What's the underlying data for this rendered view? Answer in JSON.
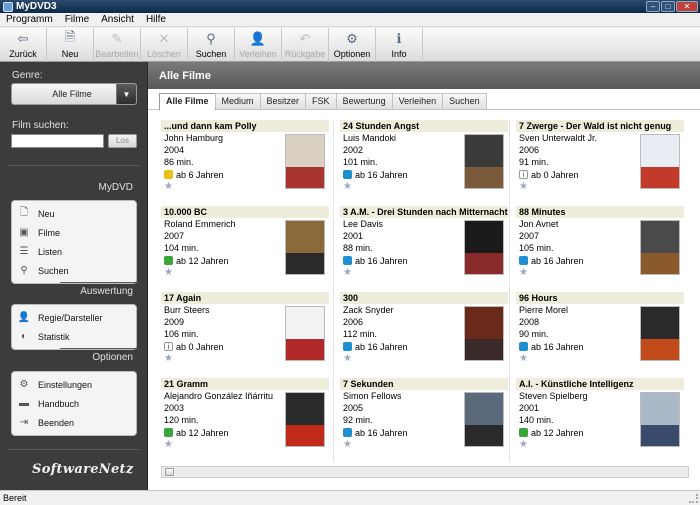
{
  "window": {
    "title": "MyDVD3"
  },
  "menu": [
    "Programm",
    "Filme",
    "Ansicht",
    "Hilfe"
  ],
  "toolbar": [
    {
      "label": "Zurück",
      "icon": "back-arrow-icon",
      "glyph": "⇦",
      "enabled": true
    },
    {
      "label": "Neu",
      "icon": "new-document-icon",
      "glyph": "🗎",
      "enabled": true
    },
    {
      "label": "Bearbeiten",
      "icon": "edit-icon",
      "glyph": "✎",
      "enabled": false
    },
    {
      "label": "Löschen",
      "icon": "delete-icon",
      "glyph": "✕",
      "enabled": false
    },
    {
      "label": "Suchen",
      "icon": "search-icon",
      "glyph": "⚲",
      "enabled": true
    },
    {
      "label": "Verleihen",
      "icon": "lend-icon",
      "glyph": "👤",
      "enabled": false
    },
    {
      "label": "Rückgabe",
      "icon": "return-icon",
      "glyph": "↶",
      "enabled": false
    },
    {
      "label": "Optionen",
      "icon": "options-gear-icon",
      "glyph": "⚙",
      "enabled": true
    },
    {
      "label": "Info",
      "icon": "info-icon",
      "glyph": "ℹ",
      "enabled": true
    }
  ],
  "sidebar": {
    "genre_label": "Genre:",
    "genre_value": "Alle Filme",
    "search_label": "Film suchen:",
    "search_value": "",
    "search_button": "Los",
    "sections": [
      {
        "title": "MyDVD",
        "items": [
          {
            "label": "Neu",
            "icon": "new-icon",
            "glyph": "🗋"
          },
          {
            "label": "Filme",
            "icon": "film-icon",
            "glyph": "▣"
          },
          {
            "label": "Listen",
            "icon": "list-icon",
            "glyph": "☰"
          },
          {
            "label": "Suchen",
            "icon": "search-icon",
            "glyph": "⚲"
          }
        ]
      },
      {
        "title": "Auswertung",
        "items": [
          {
            "label": "Regie/Darsteller",
            "icon": "person-icon",
            "glyph": "👤"
          },
          {
            "label": "Statistik",
            "icon": "chart-icon",
            "glyph": "◐"
          }
        ]
      },
      {
        "title": "Optionen",
        "items": [
          {
            "label": "Einstellungen",
            "icon": "settings-icon",
            "glyph": "⚙"
          },
          {
            "label": "Handbuch",
            "icon": "book-icon",
            "glyph": "▬"
          },
          {
            "label": "Beenden",
            "icon": "exit-icon",
            "glyph": "⇥"
          }
        ]
      }
    ],
    "logo": "SoftwareNetz"
  },
  "main": {
    "title": "Alle Filme",
    "tabs": [
      "Alle Filme",
      "Medium",
      "Besitzer",
      "FSK",
      "Bewertung",
      "Verleihen",
      "Suchen"
    ],
    "active_tab": 0
  },
  "movies": [
    {
      "title": "...und dann kam Polly",
      "director": "John Hamburg",
      "year": "2004",
      "length": "86 min.",
      "age": "ab 6 Jahren",
      "fsk_color": "#e8c018",
      "cover": [
        "#d9d0c2",
        "#a8342e"
      ]
    },
    {
      "title": "24 Stunden Angst",
      "director": "Luis Mandoki",
      "year": "2002",
      "length": "101 min.",
      "age": "ab 16 Jahren",
      "fsk_color": "#1f8fd0",
      "cover": [
        "#3a3a3a",
        "#7a5a3a"
      ]
    },
    {
      "title": "7 Zwerge - Der Wald ist nicht genug",
      "director": "Sven Unterwaldt Jr.",
      "year": "2006",
      "length": "91 min.",
      "age": "ab 0 Jahren",
      "fsk_color": "#ffffff",
      "cover": [
        "#e8eef4",
        "#c23a2a"
      ]
    },
    {
      "title": "10.000 BC",
      "director": "Roland Emmerich",
      "year": "2007",
      "length": "104 min.",
      "age": "ab 12 Jahren",
      "fsk_color": "#3aa53a",
      "cover": [
        "#8a6a3a",
        "#2a2a2a"
      ]
    },
    {
      "title": "3 A.M. - Drei Stunden nach Mitternacht",
      "director": "Lee Davis",
      "year": "2001",
      "length": "88 min.",
      "age": "ab 16 Jahren",
      "fsk_color": "#1f8fd0",
      "cover": [
        "#1a1a1a",
        "#8a2a2a"
      ]
    },
    {
      "title": "88 Minutes",
      "director": "Jon Avnet",
      "year": "2007",
      "length": "105 min.",
      "age": "ab 16 Jahren",
      "fsk_color": "#1f8fd0",
      "cover": [
        "#4a4a4a",
        "#8a5a2a"
      ]
    },
    {
      "title": "17 Again",
      "director": "Burr Steers",
      "year": "2009",
      "length": "106 min.",
      "age": "ab 0 Jahren",
      "fsk_color": "#ffffff",
      "cover": [
        "#f2f2f2",
        "#b02a2a"
      ]
    },
    {
      "title": "300",
      "director": "Zack Snyder",
      "year": "2006",
      "length": "112 min.",
      "age": "ab 16 Jahren",
      "fsk_color": "#1f8fd0",
      "cover": [
        "#6a2a1a",
        "#3a2a2a"
      ]
    },
    {
      "title": "96 Hours",
      "director": "Pierre Morel",
      "year": "2008",
      "length": "90 min.",
      "age": "ab 16 Jahren",
      "fsk_color": "#1f8fd0",
      "cover": [
        "#2a2a2a",
        "#c04a1a"
      ]
    },
    {
      "title": "21 Gramm",
      "director": "Alejandro González Iñárritu",
      "year": "2003",
      "length": "120 min.",
      "age": "ab 12 Jahren",
      "fsk_color": "#3aa53a",
      "cover": [
        "#2a2a2a",
        "#c02a1a"
      ]
    },
    {
      "title": "7 Sekunden",
      "director": "Simon Fellows",
      "year": "2005",
      "length": "92 min.",
      "age": "ab 16 Jahren",
      "fsk_color": "#1f8fd0",
      "cover": [
        "#5a6a7a",
        "#2a2a2a"
      ]
    },
    {
      "title": "A.I. - Künstliche Intelligenz",
      "director": "Steven Spielberg",
      "year": "2001",
      "length": "140 min.",
      "age": "ab 12 Jahren",
      "fsk_color": "#3aa53a",
      "cover": [
        "#aab8c8",
        "#3a4a6a"
      ]
    }
  ],
  "status": "Bereit"
}
